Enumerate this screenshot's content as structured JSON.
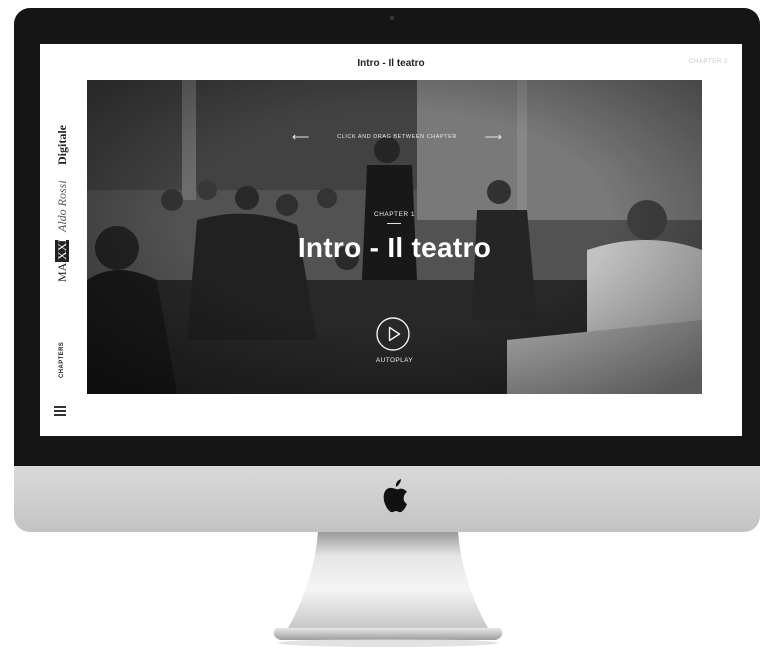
{
  "screen": {
    "title": "Intro - Il teatro",
    "next_chapter": "CHAPTER 2"
  },
  "sidebar": {
    "logo_ma": "MA",
    "logo_xxi": "XXI",
    "logo_aldo_rossi": "Aldo Rossi",
    "logo_digitale": "Digitale",
    "chapters_label": "CHAPTERS",
    "menu_icon": "hamburger-icon"
  },
  "hero": {
    "nav_hint": "CLICK AND DRAG BETWEEN CHAPTER",
    "left_arrow": "⟵",
    "right_arrow": "⟶",
    "chapter_label": "CHAPTER 1",
    "title": "Intro - Il teatro",
    "play_icon": "play-icon",
    "autoplay_label": "AUTOPLAY"
  },
  "device": {
    "logo": "apple-logo"
  }
}
